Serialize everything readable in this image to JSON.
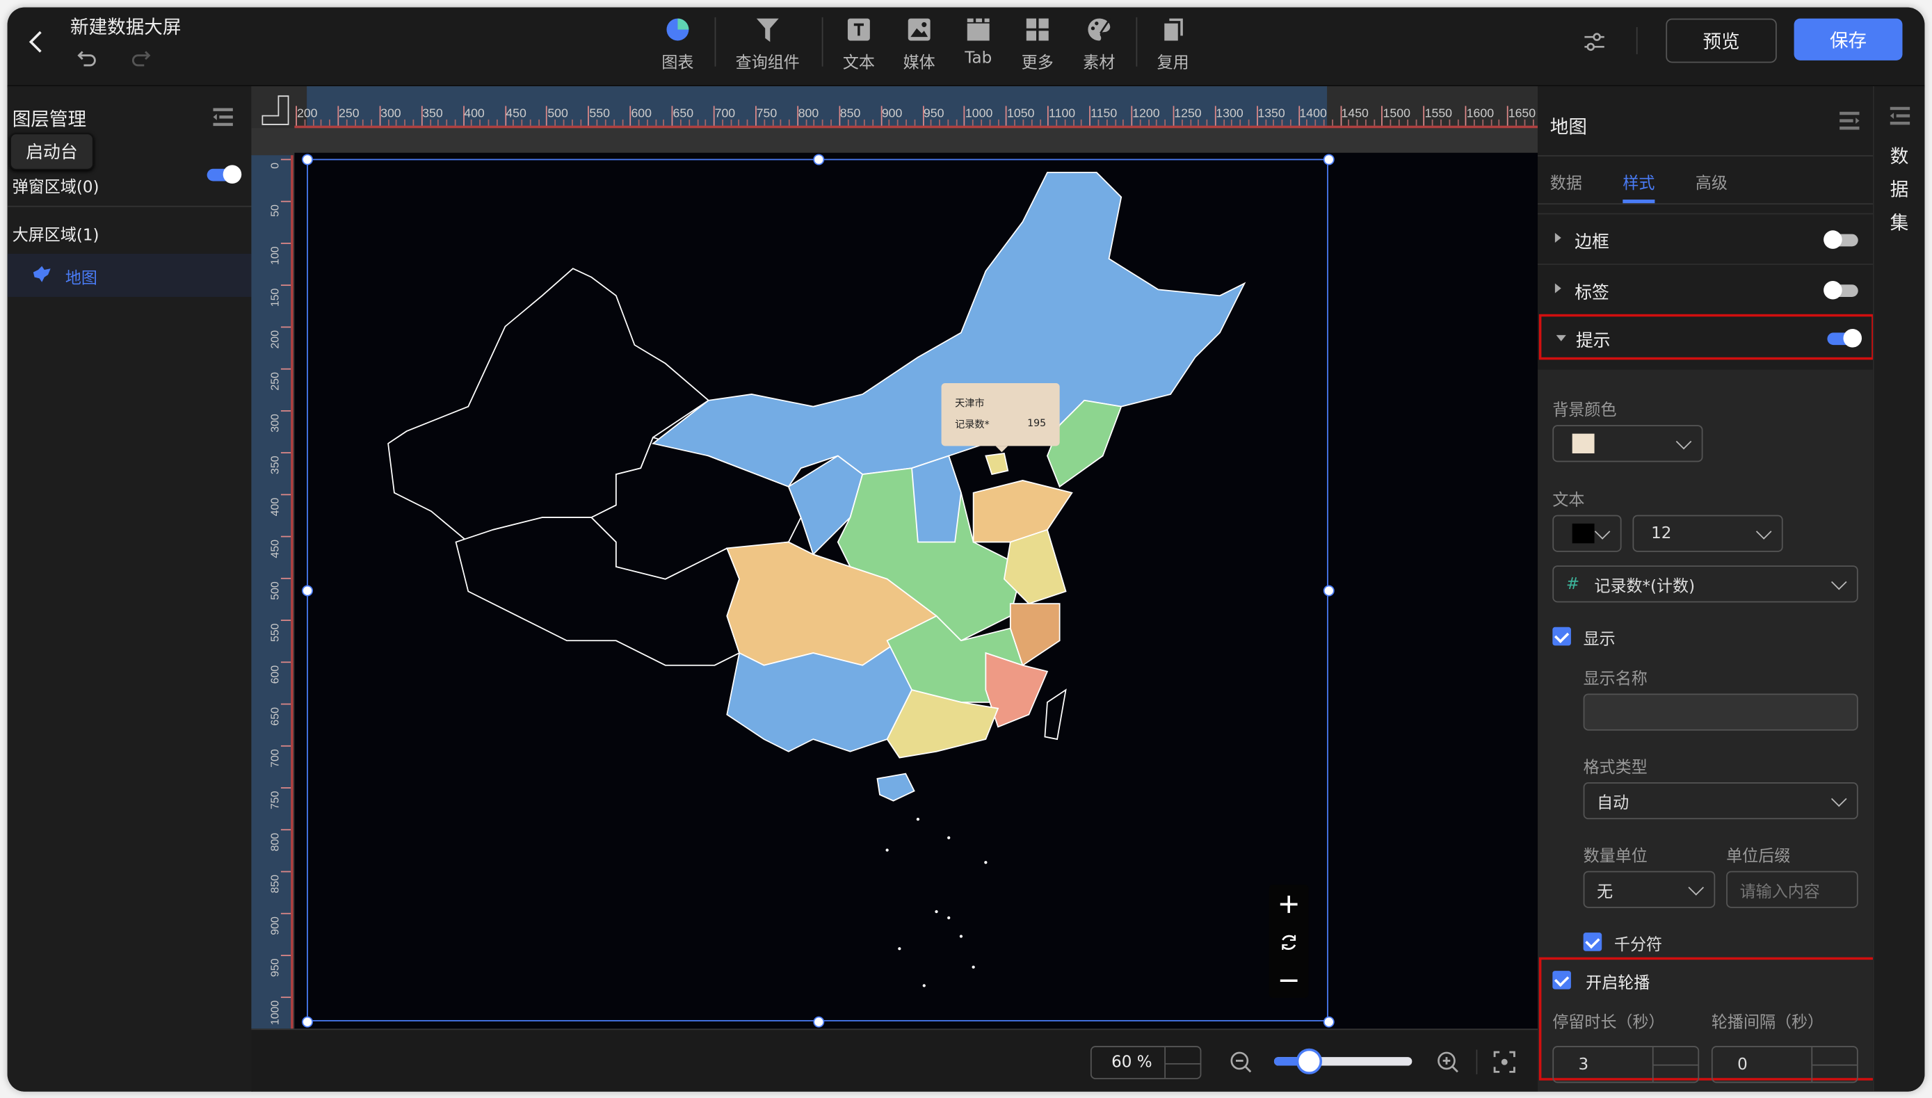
{
  "header": {
    "title": "新建数据大屏",
    "preview_label": "预览",
    "save_label": "保存",
    "toolbar": [
      {
        "label": "图表",
        "icon": "pie-chart-icon"
      },
      {
        "label": "查询组件",
        "icon": "filter-icon"
      },
      {
        "label": "文本",
        "icon": "text-icon"
      },
      {
        "label": "媒体",
        "icon": "image-icon"
      },
      {
        "label": "Tab",
        "icon": "tab-icon"
      },
      {
        "label": "更多",
        "icon": "grid-icon"
      },
      {
        "label": "素材",
        "icon": "palette-icon"
      },
      {
        "label": "复用",
        "icon": "copy-icon"
      }
    ]
  },
  "left_panel": {
    "title": "图层管理",
    "tooltip": "启动台",
    "popup_area": "弹窗区域(0)",
    "popup_toggle_on": true,
    "screen_area": "大屏区域(1)",
    "layers": [
      {
        "label": "地图",
        "icon": "map-icon",
        "selected": true
      }
    ]
  },
  "rulers": {
    "top": [
      "200",
      "250",
      "300",
      "350",
      "400",
      "450",
      "500",
      "550",
      "600",
      "650",
      "700",
      "750",
      "800",
      "850",
      "900",
      "950",
      "1000",
      "1050",
      "1100",
      "1150",
      "1200",
      "1250",
      "1300",
      "1350",
      "1400",
      "1450",
      "1500",
      "1550",
      "1600",
      "1650"
    ],
    "left": [
      "0",
      "50",
      "100",
      "150",
      "200",
      "250",
      "300",
      "350",
      "400",
      "450",
      "500",
      "550",
      "600",
      "650",
      "700",
      "750",
      "800",
      "850",
      "900",
      "950",
      "1000"
    ]
  },
  "map": {
    "tooltip": {
      "region": "天津市",
      "field": "记录数*",
      "value": "195",
      "background": "#e9d8c2"
    },
    "colors": {
      "blue": "#74ace4",
      "green": "#8dd58f",
      "orange": "#efc585",
      "yellow": "#e9dc8e",
      "dark_orange": "#e2a66e",
      "salmon": "#ee9a85",
      "background": "#03040a"
    }
  },
  "zoom": {
    "value": "60 %",
    "slider_fraction": 0.25
  },
  "right_panel": {
    "title": "地图",
    "tabs": [
      "数据",
      "样式",
      "高级"
    ],
    "active_tab": "样式",
    "sections": [
      {
        "label": "边框",
        "on": false,
        "expanded": false
      },
      {
        "label": "标签",
        "on": false,
        "expanded": false
      },
      {
        "label": "提示",
        "on": true,
        "expanded": true
      }
    ],
    "tooltip_settings": {
      "bg_color_label": "背景颜色",
      "bg_color": "#efe1cd",
      "text_label": "文本",
      "text_color": "#000000",
      "font_size": "12",
      "field": "记录数*(计数)",
      "show_label": "显示",
      "show_checked": true,
      "display_name_label": "显示名称",
      "display_name_value": "",
      "format_type_label": "格式类型",
      "format_type": "自动",
      "unit_label": "数量单位",
      "unit": "无",
      "suffix_label": "单位后缀",
      "suffix_placeholder": "请输入内容",
      "thousands_label": "千分符",
      "thousands_checked": true,
      "carousel_label": "开启轮播",
      "carousel_checked": true,
      "dwell_label": "停留时长（秒）",
      "dwell": "3",
      "interval_label": "轮播间隔（秒）",
      "interval": "0"
    }
  },
  "side_strip": {
    "label": "数据集"
  }
}
